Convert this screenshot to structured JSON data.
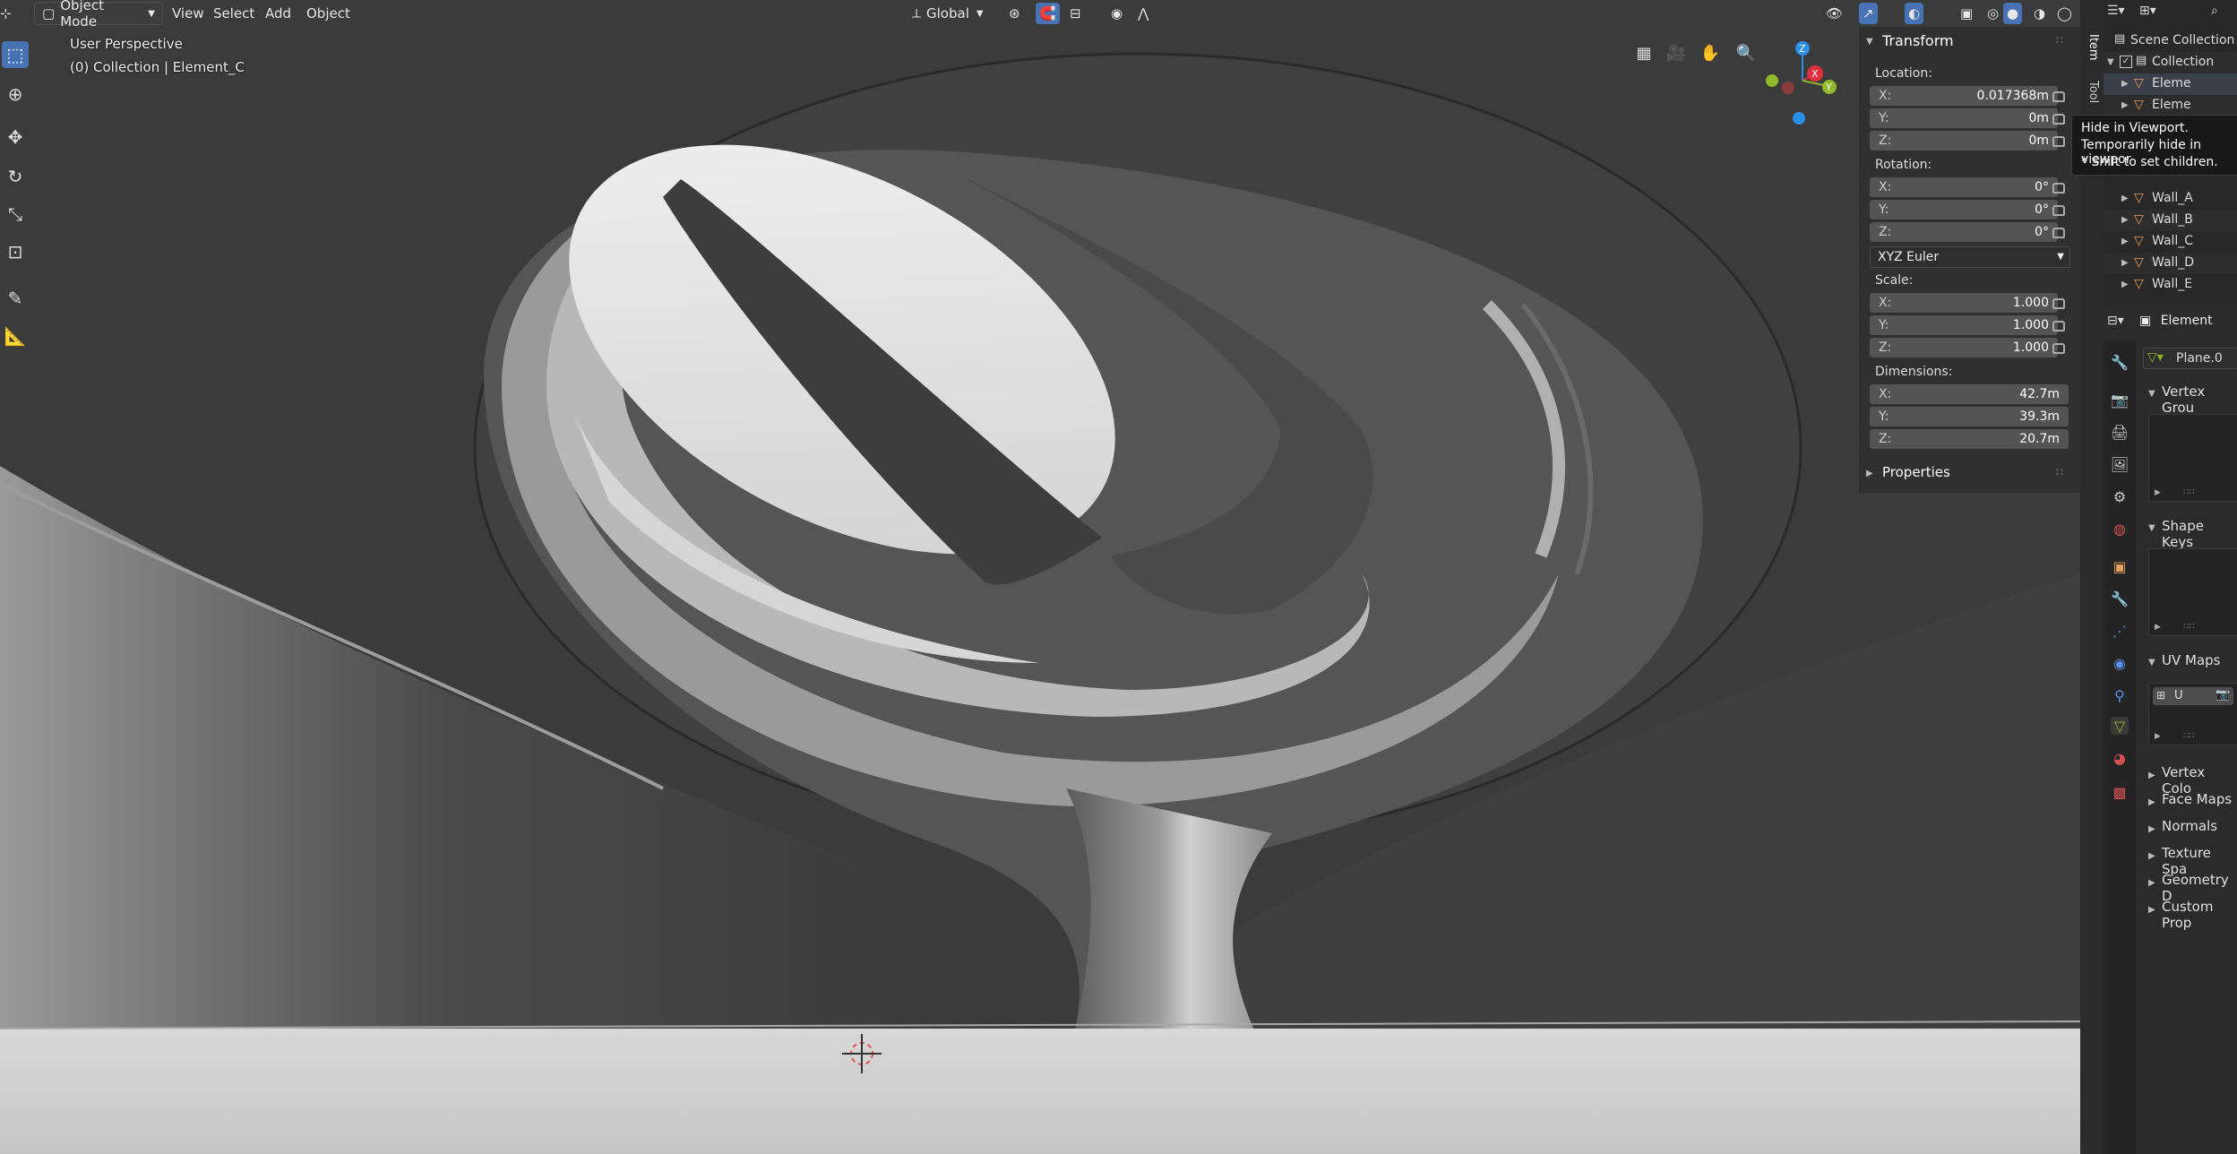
{
  "header": {
    "mode": "Object Mode",
    "menus": [
      "View",
      "Select",
      "Add",
      "Object"
    ],
    "orientation": "Global"
  },
  "viewport": {
    "perspective": "User Perspective",
    "collection_info": "(0) Collection | Element_C"
  },
  "gizmo": {
    "z": "Z",
    "x": "X",
    "y": "Y"
  },
  "npanel": {
    "title": "Transform",
    "location_label": "Location:",
    "location": {
      "x": "0.017368m",
      "y": "0m",
      "z": "0m"
    },
    "rotation_label": "Rotation:",
    "rotation": {
      "x": "0°",
      "y": "0°",
      "z": "0°"
    },
    "rotation_mode": "XYZ Euler",
    "scale_label": "Scale:",
    "scale": {
      "x": "1.000",
      "y": "1.000",
      "z": "1.000"
    },
    "dimensions_label": "Dimensions:",
    "dimensions": {
      "x": "42.7m",
      "y": "39.3m",
      "z": "20.7m"
    },
    "properties_label": "Properties",
    "axis": {
      "x": "X:",
      "y": "Y:",
      "z": "Z:"
    }
  },
  "vtabs": {
    "item": "Item",
    "tool": "Tool"
  },
  "outliner": {
    "root": "Scene Collection",
    "collection": "Collection",
    "items": [
      "Eleme",
      "Eleme",
      "Wall_A",
      "Wall_B",
      "Wall_C",
      "Wall_D",
      "Wall_E"
    ]
  },
  "tooltip": {
    "title": "Hide in Viewport.",
    "desc": "Temporarily hide in viewpor",
    "hint": "* Shift to set children."
  },
  "properties": {
    "object_name": "Element",
    "mesh_name": "Plane.0",
    "sections": {
      "vertex_groups": "Vertex Grou",
      "shape_keys": "Shape Keys",
      "uv_maps": "UV Maps",
      "uv_item": "U",
      "vertex_colors": "Vertex Colo",
      "face_maps": "Face Maps",
      "normals": "Normals",
      "texture_space": "Texture Spa",
      "geometry_data": "Geometry D",
      "custom_props": "Custom Prop"
    }
  },
  "colors": {
    "accent": "#4772b3",
    "axis_x": "#e0303f",
    "axis_y": "#8fb82a",
    "axis_z": "#2c8fe6",
    "mesh_icon": "#e8a15a"
  }
}
